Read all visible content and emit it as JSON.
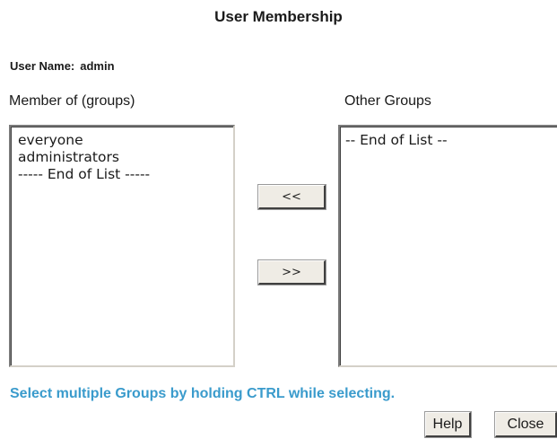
{
  "header": {
    "title": "User Membership"
  },
  "user": {
    "label": "User Name:",
    "value": "admin"
  },
  "member_of": {
    "label": "Member of (groups)",
    "items": [
      "everyone",
      "administrators",
      "----- End of List -----"
    ]
  },
  "other_groups": {
    "label": "Other Groups",
    "items": [
      "-- End of List --"
    ]
  },
  "buttons": {
    "add_label": "<<",
    "remove_label": ">>",
    "help_label": "Help",
    "close_label": "Close"
  },
  "hint": {
    "text": "Select multiple Groups by holding CTRL while selecting."
  },
  "colors": {
    "hint": "#3a9bcc",
    "button_face": "#efece5"
  }
}
